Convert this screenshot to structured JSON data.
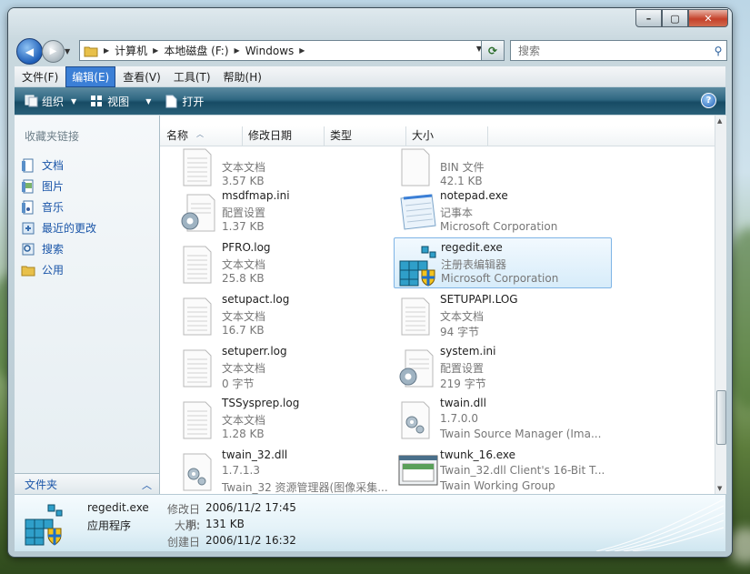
{
  "address": {
    "segments": [
      "计算机",
      "本地磁盘 (F:)",
      "Windows"
    ]
  },
  "search": {
    "placeholder": "搜索"
  },
  "menu": {
    "items": [
      "文件(F)",
      "编辑(E)",
      "查看(V)",
      "工具(T)",
      "帮助(H)"
    ],
    "selected_index": 1
  },
  "toolbar": {
    "organize": "组织",
    "views": "视图",
    "open": "打开"
  },
  "nav": {
    "header": "收藏夹链接",
    "links": [
      "文档",
      "图片",
      "音乐",
      "最近的更改",
      "搜索",
      "公用"
    ],
    "folders_label": "文件夹"
  },
  "columns": [
    "名称",
    "修改日期",
    "类型",
    "大小"
  ],
  "files": [
    {
      "name": "",
      "type": "文本文档",
      "info": "3.57 KB",
      "icon": "text-file-icon"
    },
    {
      "name": "",
      "type": "BIN 文件",
      "info": "42.1 KB",
      "icon": "blank-file-icon"
    },
    {
      "name": "msdfmap.ini",
      "type": "配置设置",
      "info": "1.37 KB",
      "icon": "config-file-icon"
    },
    {
      "name": "notepad.exe",
      "type": "记事本",
      "info": "Microsoft Corporation",
      "icon": "notepad-icon"
    },
    {
      "name": "PFRO.log",
      "type": "文本文档",
      "info": "25.8 KB",
      "icon": "text-file-icon"
    },
    {
      "name": "regedit.exe",
      "type": "注册表编辑器",
      "info": "Microsoft Corporation",
      "icon": "regedit-icon"
    },
    {
      "name": "setupact.log",
      "type": "文本文档",
      "info": "16.7 KB",
      "icon": "text-file-icon"
    },
    {
      "name": "SETUPAPI.LOG",
      "type": "文本文档",
      "info": "94 字节",
      "icon": "text-file-icon"
    },
    {
      "name": "setuperr.log",
      "type": "文本文档",
      "info": "0 字节",
      "icon": "text-file-icon"
    },
    {
      "name": "system.ini",
      "type": "配置设置",
      "info": "219 字节",
      "icon": "config-file-icon"
    },
    {
      "name": "TSSysprep.log",
      "type": "文本文档",
      "info": "1.28 KB",
      "icon": "text-file-icon"
    },
    {
      "name": "twain.dll",
      "type": "1.7.0.0",
      "info": "Twain Source Manager (Ima...",
      "icon": "dll-file-icon"
    },
    {
      "name": "twain_32.dll",
      "type": "1.7.1.3",
      "info": "Twain_32 资源管理器(图像采集...",
      "icon": "dll-file-icon"
    },
    {
      "name": "twunk_16.exe",
      "type": "Twain_32.dll Client's 16-Bit T...",
      "info": "Twain Working Group",
      "icon": "app-window-icon"
    }
  ],
  "selected_file_index": 5,
  "details": {
    "name": "regedit.exe",
    "kind": "应用程序",
    "modified_label": "修改日期:",
    "modified": "2006/11/2 17:45",
    "size_label": "大小:",
    "size": "131 KB",
    "created_label": "创建日期:",
    "created": "2006/11/2 16:32"
  },
  "colors": {
    "accent": "#3b7fd6",
    "toolbar": "#2f6782",
    "link": "#1a55a8"
  }
}
